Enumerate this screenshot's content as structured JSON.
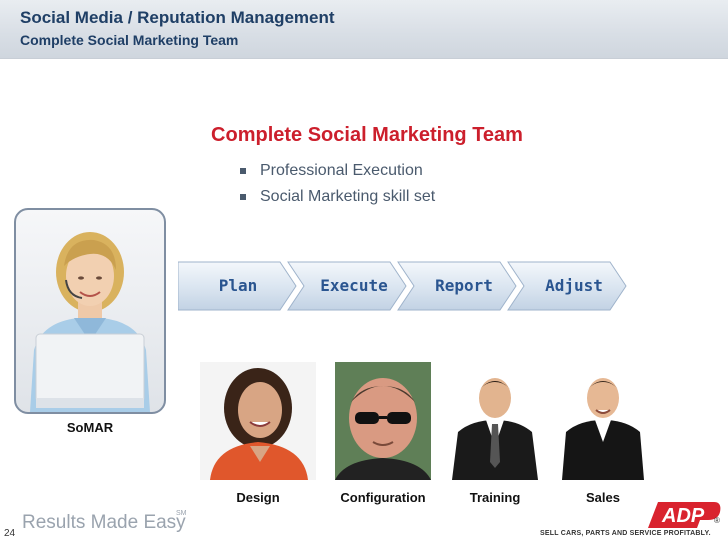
{
  "header": {
    "title": "Social Media / Reputation Management",
    "subtitle": "Complete Social Marketing Team"
  },
  "main": {
    "title": "Complete Social Marketing Team",
    "bullets": [
      "Professional Execution",
      "Social Marketing skill set"
    ]
  },
  "somar": {
    "label": "SoMAR"
  },
  "steps": [
    "Plan",
    "Execute",
    "Report",
    "Adjust"
  ],
  "team": [
    {
      "caption": "Design"
    },
    {
      "caption": "Configuration"
    },
    {
      "caption": "Training"
    },
    {
      "caption": "Sales"
    }
  ],
  "footer": {
    "slide_number": "24",
    "tagline": "Results Made Easy",
    "sm_mark": "SM",
    "adp_tagline": "SELL CARS, PARTS AND SERVICE PROFITABLY.",
    "adp_logo_text": "ADP",
    "adp_registered": "®"
  },
  "colors": {
    "header_text": "#1f3f66",
    "title_red": "#cc1f2c",
    "bullet_text": "#4a5a6d",
    "step_text": "#2a5590",
    "adp_red": "#d9232e",
    "tagline_gray": "#9aa3ae"
  }
}
